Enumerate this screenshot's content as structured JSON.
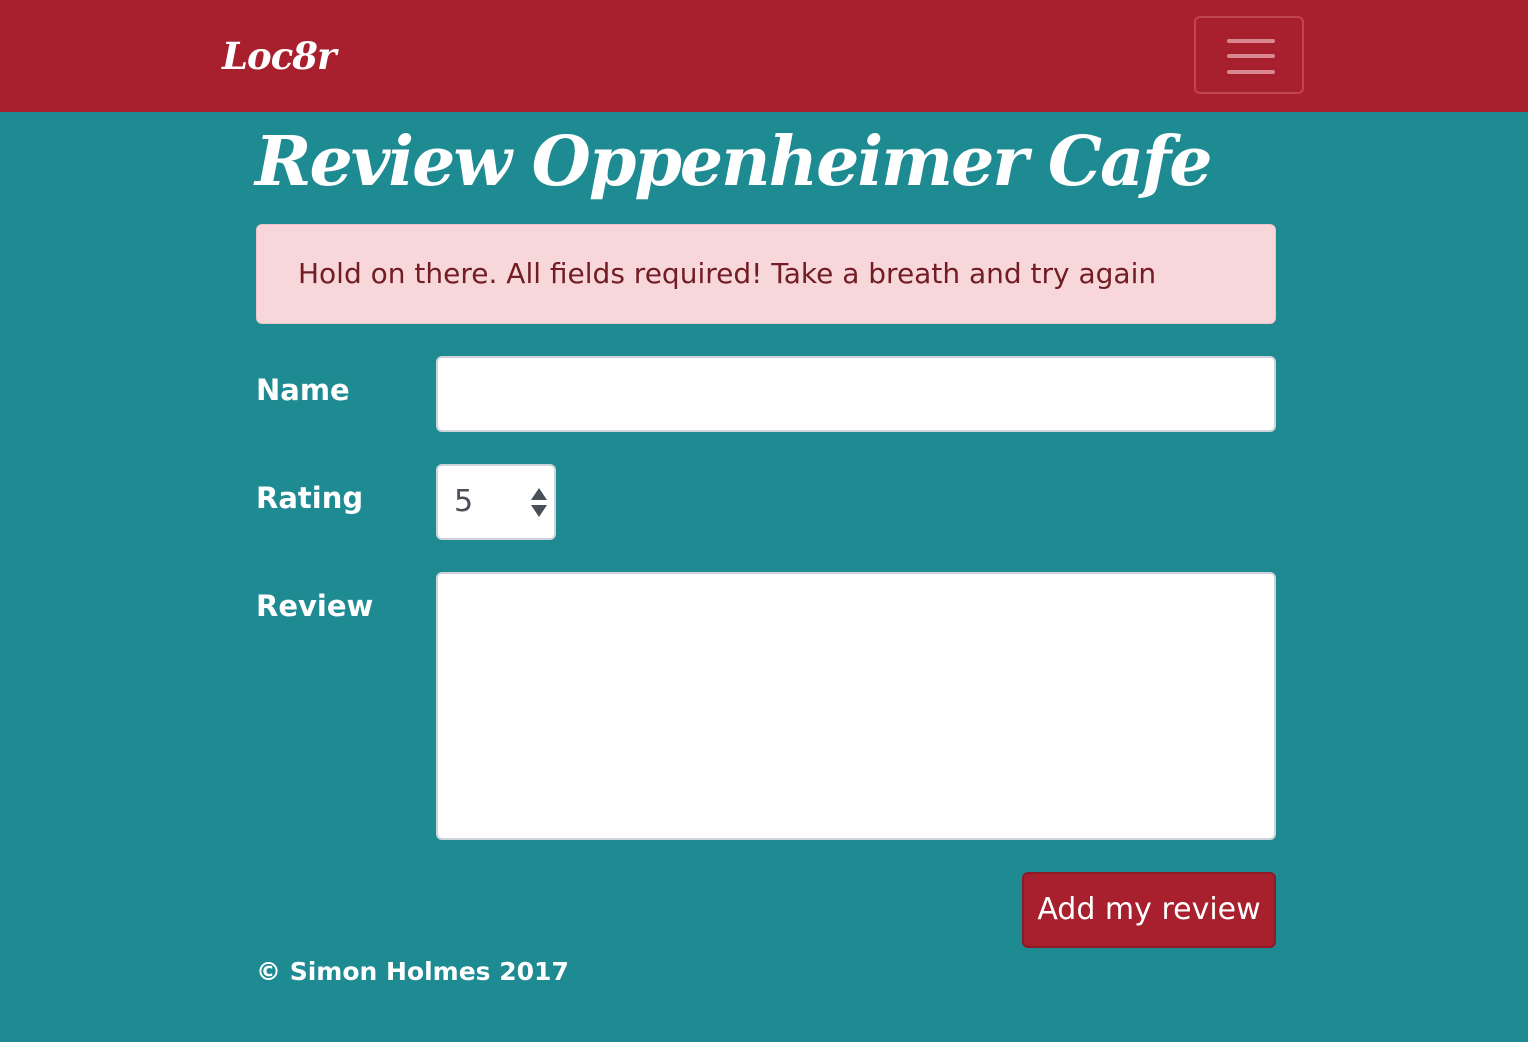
{
  "navbar": {
    "brand": "Loc8r",
    "toggle_icon": "hamburger-menu-icon"
  },
  "page": {
    "title": "Review Oppenheimer Cafe"
  },
  "alert": {
    "message": "Hold on there. All fields required! Take a breath and try again"
  },
  "form": {
    "name_label": "Name",
    "name_value": "",
    "rating_label": "Rating",
    "rating_value": "5",
    "review_label": "Review",
    "review_value": "",
    "submit_label": "Add my review"
  },
  "footer": {
    "copyright": "© Simon Holmes 2017"
  },
  "colors": {
    "navbar_bg": "#a81f2d",
    "page_bg": "#1e8a92",
    "alert_bg": "#f8d7da",
    "alert_text": "#721c24",
    "button_bg": "#a81f2d"
  }
}
